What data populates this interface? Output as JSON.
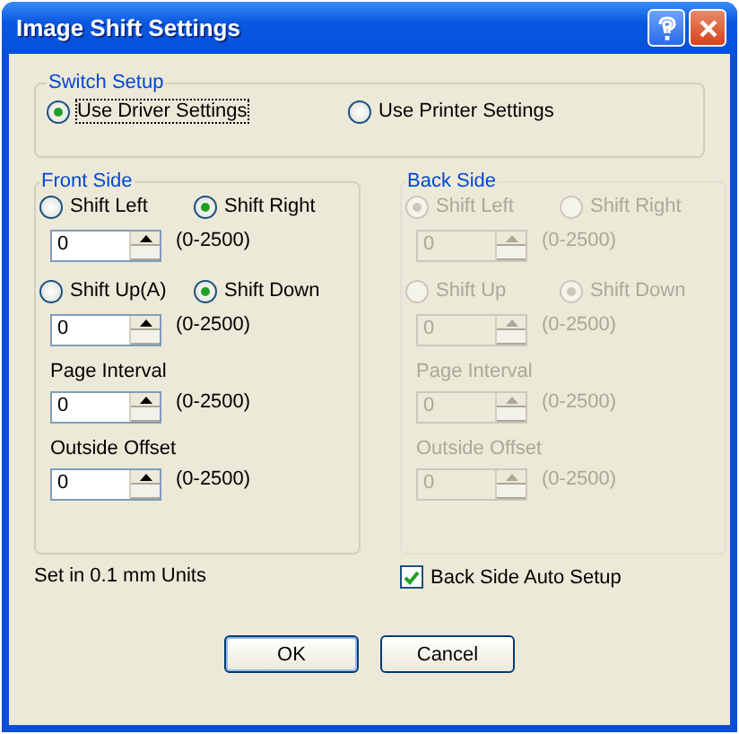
{
  "window": {
    "title": "Image Shift Settings"
  },
  "switch_setup": {
    "title": "Switch Setup",
    "options": [
      {
        "label": "Use Driver Settings",
        "selected": true
      },
      {
        "label": "Use Printer Settings",
        "selected": false
      }
    ]
  },
  "panels": [
    {
      "title": "Front Side",
      "disabled": false,
      "rows": [
        {
          "kind": "radios",
          "options": [
            {
              "label": "Shift Left",
              "selected": false
            },
            {
              "label": "Shift Right",
              "selected": true
            }
          ]
        },
        {
          "kind": "spin",
          "value": "0",
          "range": "(0-2500)"
        },
        {
          "kind": "radios",
          "options": [
            {
              "label": "Shift Up(A)",
              "selected": false
            },
            {
              "label": "Shift Down",
              "selected": true
            }
          ]
        },
        {
          "kind": "spin",
          "value": "0",
          "range": "(0-2500)"
        },
        {
          "kind": "label",
          "text": "Page Interval"
        },
        {
          "kind": "spin",
          "value": "0",
          "range": "(0-2500)"
        },
        {
          "kind": "label",
          "text": "Outside Offset"
        },
        {
          "kind": "spin",
          "value": "0",
          "range": "(0-2500)"
        }
      ]
    },
    {
      "title": "Back Side",
      "disabled": true,
      "rows": [
        {
          "kind": "radios",
          "options": [
            {
              "label": "Shift Left",
              "selected": true
            },
            {
              "label": "Shift Right",
              "selected": false
            }
          ]
        },
        {
          "kind": "spin",
          "value": "0",
          "range": "(0-2500)"
        },
        {
          "kind": "radios",
          "options": [
            {
              "label": "Shift Up",
              "selected": false
            },
            {
              "label": "Shift Down",
              "selected": true
            }
          ]
        },
        {
          "kind": "spin",
          "value": "0",
          "range": "(0-2500)"
        },
        {
          "kind": "label",
          "text": "Page Interval"
        },
        {
          "kind": "spin",
          "value": "0",
          "range": "(0-2500)"
        },
        {
          "kind": "label",
          "text": "Outside Offset"
        },
        {
          "kind": "spin",
          "value": "0",
          "range": "(0-2500)"
        }
      ]
    }
  ],
  "units_note": "Set in 0.1 mm Units",
  "auto_setup": {
    "label": "Back Side Auto Setup",
    "checked": true
  },
  "buttons": [
    "OK",
    "Cancel"
  ]
}
